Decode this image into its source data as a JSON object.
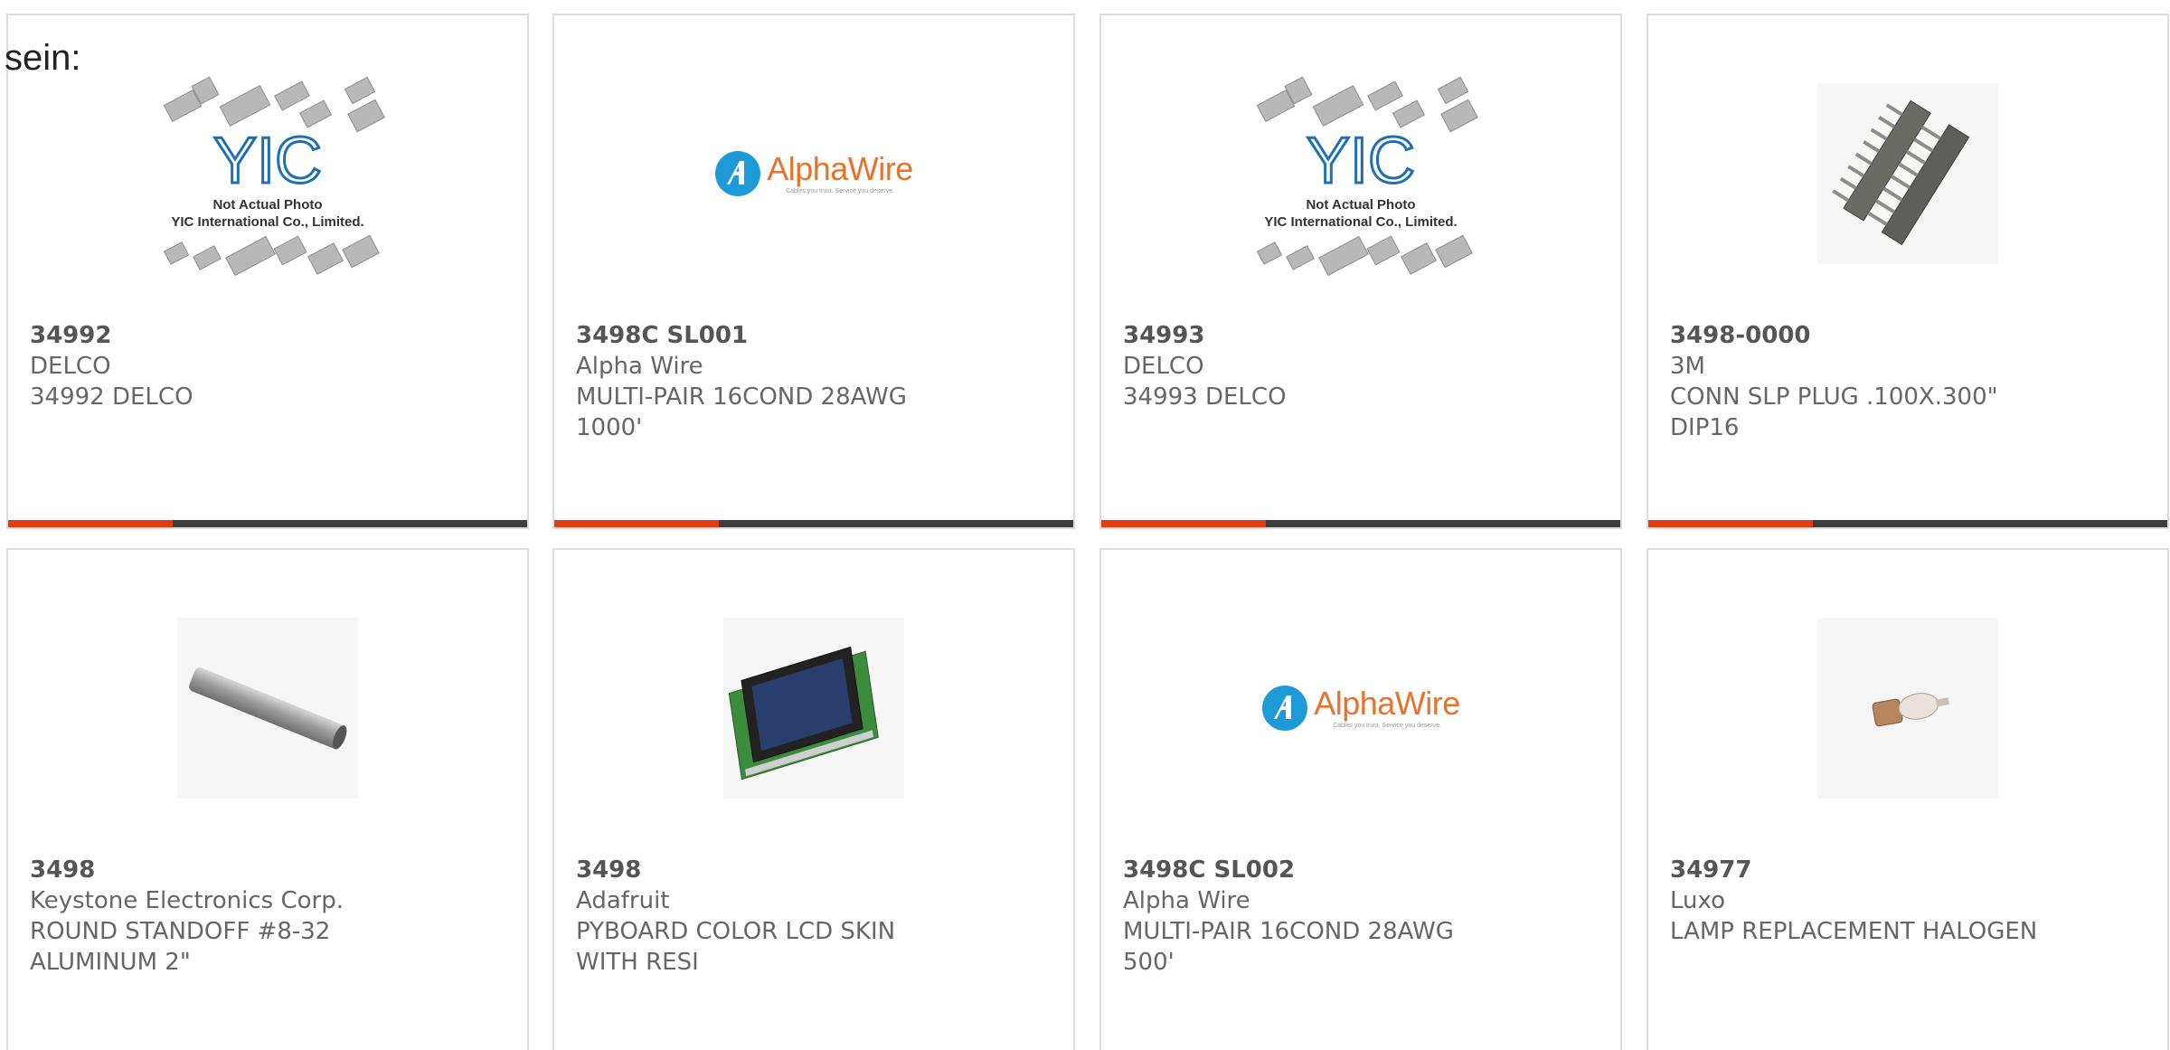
{
  "overlay_text": "sein:",
  "yic_placeholder": {
    "line1": "Not Actual Photo",
    "line2": "YIC International Co., Limited.",
    "logo": "YIC"
  },
  "alpha_logo": {
    "wordmark": "AlphaWire",
    "tagline": "Cables you trust. Service you deserve."
  },
  "colors": {
    "accent": "#e63c14",
    "bar": "#3d3d3d",
    "text": "#666666",
    "border": "#dcdcdc",
    "alpha_blue": "#1e9bd7",
    "alpha_orange": "#e8722a"
  },
  "products": [
    {
      "part": "34992",
      "maker": "DELCO",
      "desc_lines": [
        "34992 DELCO"
      ],
      "image": "yic-placeholder"
    },
    {
      "part": "3498C SL001",
      "maker": "Alpha Wire",
      "desc_lines": [
        "MULTI-PAIR 16COND 28AWG",
        "1000'"
      ],
      "image": "alphawire-logo"
    },
    {
      "part": "34993",
      "maker": "DELCO",
      "desc_lines": [
        "34993 DELCO"
      ],
      "image": "yic-placeholder"
    },
    {
      "part": "3498-0000",
      "maker": "3M",
      "desc_lines": [
        "CONN SLP PLUG .100X.300\"",
        "DIP16"
      ],
      "image": "connector-photo"
    },
    {
      "part": "3498",
      "maker": "Keystone Electronics Corp.",
      "desc_lines": [
        "ROUND STANDOFF #8-32",
        "ALUMINUM 2\""
      ],
      "image": "standoff-photo"
    },
    {
      "part": "3498",
      "maker": "Adafruit",
      "desc_lines": [
        "PYBOARD COLOR LCD SKIN",
        "WITH RESI"
      ],
      "image": "lcd-board-photo"
    },
    {
      "part": "3498C SL002",
      "maker": "Alpha Wire",
      "desc_lines": [
        "MULTI-PAIR 16COND 28AWG",
        "500'"
      ],
      "image": "alphawire-logo"
    },
    {
      "part": "34977",
      "maker": "Luxo",
      "desc_lines": [
        "LAMP REPLACEMENT HALOGEN"
      ],
      "image": "halogen-lamp-photo"
    }
  ]
}
